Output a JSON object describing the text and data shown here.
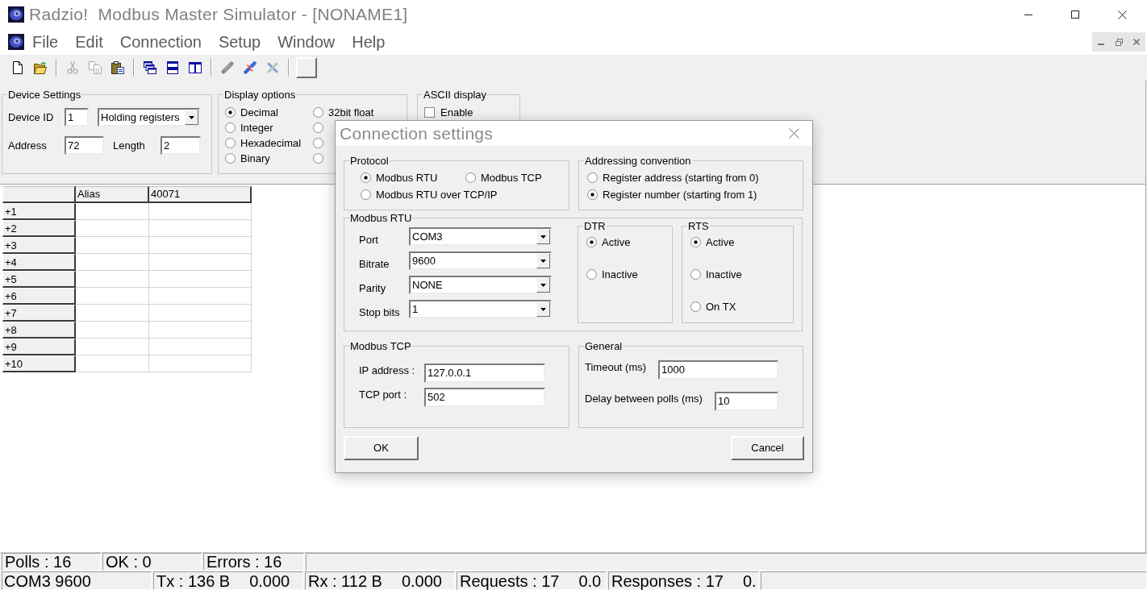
{
  "window": {
    "title": "Radzio!  Modbus Master Simulator - [NONAME1]"
  },
  "menu": [
    "File",
    "Edit",
    "Connection",
    "Setup",
    "Window",
    "Help"
  ],
  "toolbar": [
    {
      "buttons": [
        {
          "disabled": false
        },
        {
          "disabled": false
        }
      ]
    },
    {
      "buttons": [
        {
          "disabled": true
        },
        {
          "disabled": true
        },
        {
          "disabled": false
        }
      ]
    },
    {
      "buttons": [
        {
          "disabled": false
        },
        {
          "disabled": false
        },
        {
          "disabled": false
        }
      ]
    },
    {
      "buttons": [
        {
          "disabled": true
        },
        {
          "disabled": false
        },
        {
          "disabled": false
        }
      ]
    },
    {
      "buttons": [
        {
          "disabled": false
        }
      ]
    }
  ],
  "device_settings": {
    "title": "Device Settings",
    "device_id_label": "Device ID",
    "device_id": "1",
    "register_type": "Holding registers",
    "address_label": "Address",
    "address": "72",
    "length_label": "Length",
    "length": "2"
  },
  "display_options": {
    "title": "Display options",
    "options": [
      {
        "label": "Decimal",
        "selected": true
      },
      {
        "label": "Integer",
        "selected": false
      },
      {
        "label": "Hexadecimal",
        "selected": false
      },
      {
        "label": "Binary",
        "selected": false
      },
      {
        "label": "32bit float",
        "selected": false
      },
      {
        "selected": false
      },
      {
        "selected": false
      },
      {
        "selected": false
      }
    ]
  },
  "ascii_display": {
    "title": "ASCII display",
    "enable": {
      "label": "Enable",
      "checked": false
    }
  },
  "table": {
    "columns": [
      "Alias",
      "40071"
    ],
    "rows": [
      "+1",
      "+2",
      "+3",
      "+4",
      "+5",
      "+6",
      "+7",
      "+8",
      "+9",
      "+10"
    ]
  },
  "status_bar": {
    "row_1": [
      "Polls : 16",
      "OK : 0",
      "Errors : 16"
    ],
    "row_2": [
      {
        "text": "COM3 9600"
      },
      {
        "text": "Tx : 136 B",
        "rate": "0.000"
      },
      {
        "text": "Rx : 112 B",
        "rate": "0.000"
      },
      {
        "text": "Requests : 17",
        "rate": "0.0"
      },
      {
        "text": "Responses : 17",
        "rate": "0."
      }
    ]
  },
  "dialog": {
    "title": "Connection settings",
    "protocol": {
      "title": "Protocol",
      "options": [
        {
          "label": "Modbus RTU",
          "selected": true
        },
        {
          "label": "Modbus TCP",
          "selected": false
        },
        {
          "label": "Modbus RTU over TCP/IP",
          "selected": false
        }
      ]
    },
    "addressing": {
      "title": "Addressing convention",
      "options": [
        {
          "label": "Register address (starting from 0)",
          "selected": false
        },
        {
          "label": "Register number (starting from 1)",
          "selected": true
        }
      ]
    },
    "modbus_rtu": {
      "title": "Modbus RTU",
      "fields": [
        {
          "label": "Port",
          "value": "COM3"
        },
        {
          "label": "Bitrate",
          "value": "9600"
        },
        {
          "label": "Parity",
          "value": "NONE"
        },
        {
          "label": "Stop bits",
          "value": "1"
        }
      ]
    },
    "dtr": {
      "title": "DTR",
      "options": [
        {
          "label": "Active",
          "selected": true
        },
        {
          "label": "Inactive",
          "selected": false
        }
      ]
    },
    "rts": {
      "title": "RTS",
      "options": [
        {
          "label": "Active",
          "selected": true
        },
        {
          "label": "Inactive",
          "selected": false
        },
        {
          "label": "On TX",
          "selected": false
        }
      ]
    },
    "modbus_tcp": {
      "title": "Modbus TCP",
      "fields": [
        {
          "label": "IP address :",
          "value": "127.0.0.1"
        },
        {
          "label": "TCP port :",
          "value": "502"
        }
      ]
    },
    "general": {
      "title": "General",
      "fields": [
        {
          "label": "Timeout (ms)",
          "value": "1000"
        },
        {
          "label": "Delay between polls (ms)",
          "value": "10"
        }
      ]
    },
    "buttons": [
      "OK",
      "Cancel"
    ]
  }
}
